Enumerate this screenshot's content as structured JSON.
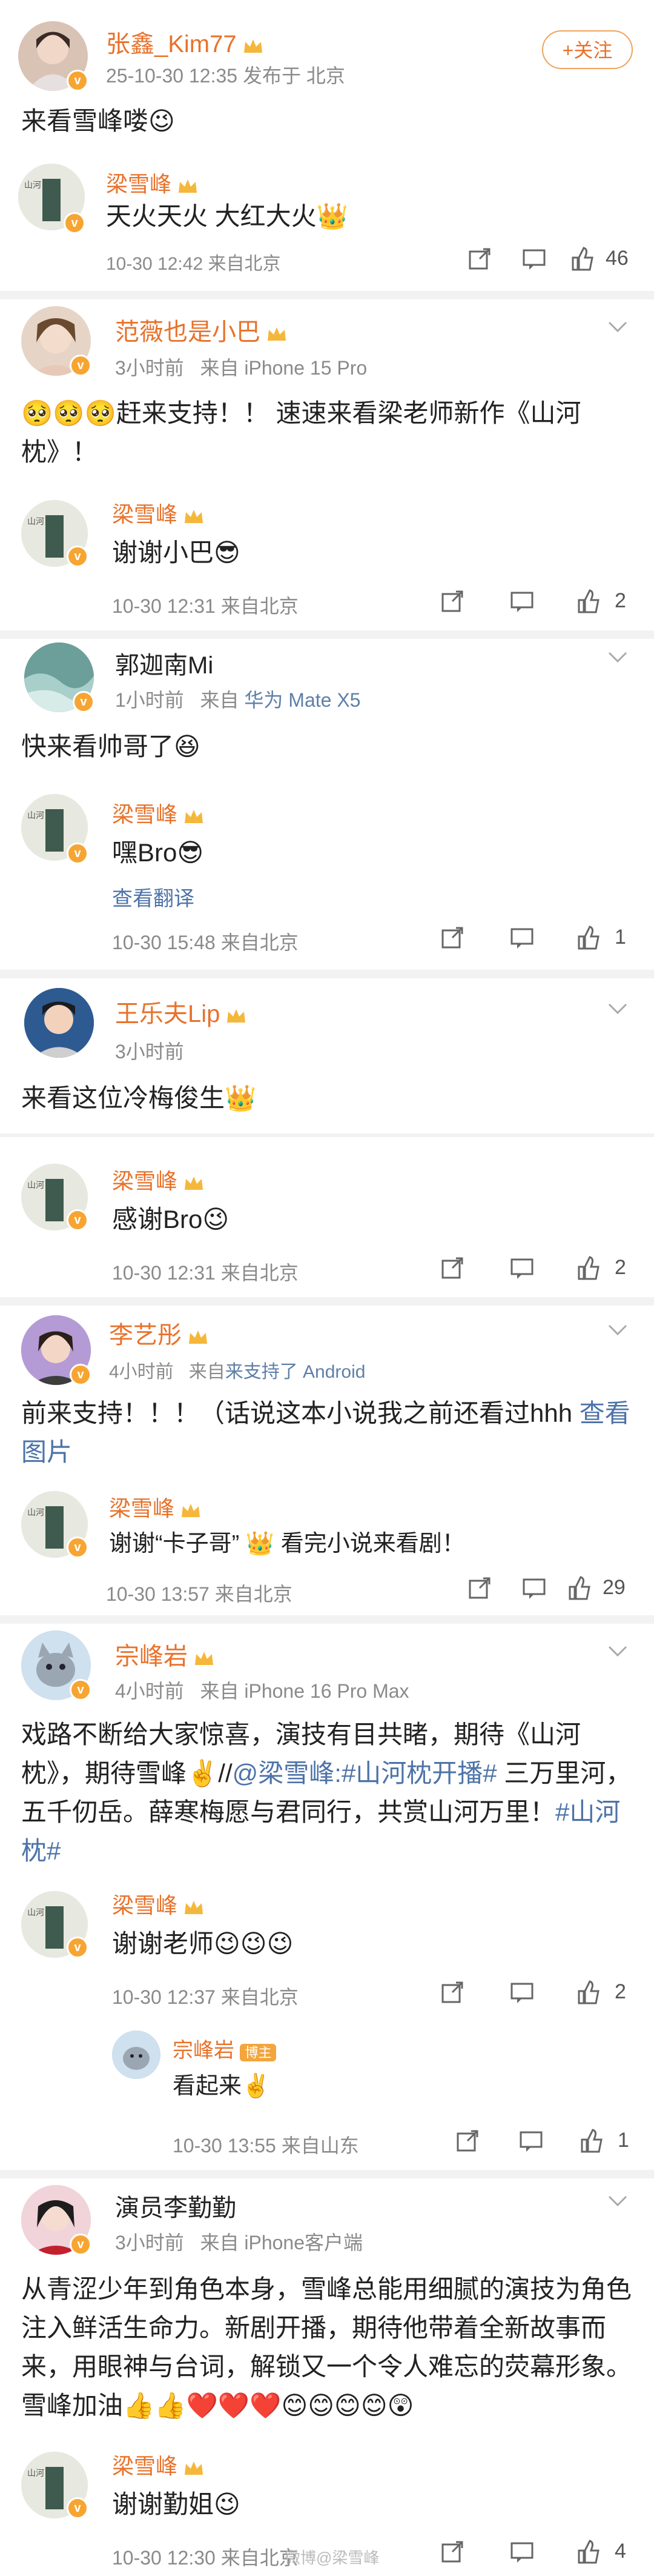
{
  "follow_label": "+关注",
  "threads": [
    {
      "name": "张鑫_Kim77",
      "meta": "25-10-30 12:35 发布于 北京",
      "text": "来看雪峰喽😉",
      "reply": {
        "name": "梁雪峰",
        "text": "天火天火 大红大火👑",
        "meta": "10-30 12:42 来自北京",
        "likes": "46"
      }
    },
    {
      "name": "范薇也是小巴",
      "meta_time": "3小时前",
      "meta_src": "来自 iPhone 15 Pro",
      "text": "🥺🥺🥺赶来支持！！ 速速来看梁老师新作《山河枕》！",
      "reply": {
        "name": "梁雪峰",
        "text": "谢谢小巴😎",
        "meta": "10-30 12:31 来自北京",
        "likes": "2"
      }
    },
    {
      "name": "郭迦南Mi",
      "meta_time": "1小时前",
      "meta_src_prefix": "来自",
      "meta_src": "华为 Mate X5",
      "text": "快来看帅哥了😆",
      "reply": {
        "name": "梁雪峰",
        "text": "嘿Bro😎",
        "translate": "查看翻译",
        "meta": "10-30 15:48 来自北京",
        "likes": "1"
      }
    },
    {
      "name": "王乐夫Lip",
      "meta_time": "3小时前",
      "text": "来看这位冷梅俊生👑",
      "reply": {
        "name": "梁雪峰",
        "text": "感谢Bro😉",
        "meta": "10-30 12:31 来自北京",
        "likes": "2"
      }
    },
    {
      "name": "李艺彤",
      "meta_time": "4小时前",
      "meta_src_prefix": "来自",
      "meta_src": "来支持了 Android",
      "text_a": "前来支持！！！（话说这本小说我之前还看过hhh ",
      "text_link": "查看图片",
      "reply": {
        "name": "梁雪峰",
        "text": "谢谢“卡子哥” 👑 看完小说来看剧！",
        "meta": "10-30 13:57 来自北京",
        "likes": "29"
      }
    },
    {
      "name": "宗峰岩",
      "meta_time": "4小时前",
      "meta_src": "来自 iPhone 16 Pro Max",
      "text_a": "戏路不断给大家惊喜，演技有目共睹，期待《山河枕》，期待雪峰✌️//",
      "text_link1": "@梁雪峰:#山河枕开播#",
      "text_b": "三万里河，五千仞岳。薛寒梅愿与君同行，共赏山河万里！",
      "text_link2": "#山河枕#",
      "reply": {
        "name": "梁雪峰",
        "text": "谢谢老师😉😉😉",
        "meta": "10-30 12:37 来自北京",
        "likes": "2"
      },
      "reply2": {
        "name": "宗峰岩",
        "badge": "博主",
        "text": "看起来✌️",
        "meta": "10-30 13:55 来自山东",
        "likes": "1"
      }
    },
    {
      "name": "演员李勤勤",
      "meta_time": "3小时前",
      "meta_src": "来自 iPhone客户端",
      "text": "从青涩少年到角色本身，雪峰总能用细腻的演技为角色注入鲜活生命力。新剧开播，期待他带着全新故事而来，用眼神与台词，解锁又一个令人难忘的荧幕形象。雪峰加油👍👍❤️❤️❤️😊😊😊😊😲",
      "reply": {
        "name": "梁雪峰",
        "text": "谢谢勤姐😉",
        "meta": "10-30 12:30 来自北京",
        "likes": "4"
      }
    }
  ],
  "watermark": "微博@梁雪峰",
  "icon_names": [
    "share-icon",
    "comment-icon",
    "like-icon",
    "chevron-down-icon",
    "crown-icon",
    "verified-icon"
  ]
}
